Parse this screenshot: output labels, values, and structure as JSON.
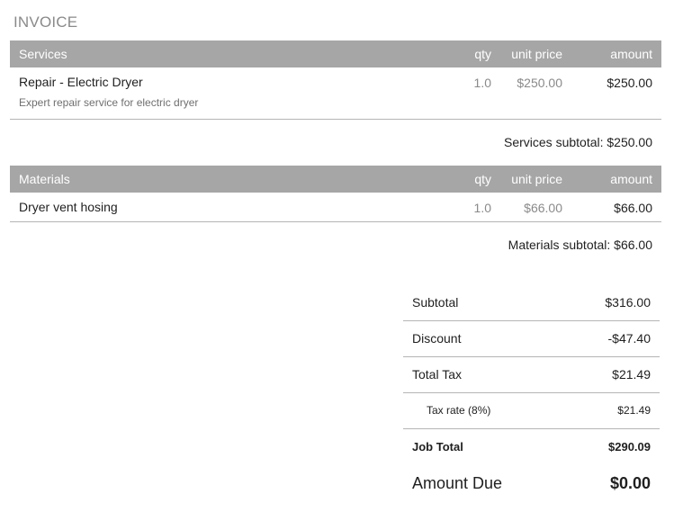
{
  "title": "INVOICE",
  "services": {
    "header": {
      "name": "Services",
      "qty": "qty",
      "unit_price": "unit price",
      "amount": "amount"
    },
    "items": [
      {
        "name": "Repair - Electric Dryer",
        "description": "Expert repair service for electric dryer",
        "qty": "1.0",
        "unit_price": "$250.00",
        "amount": "$250.00"
      }
    ],
    "subtotal": "Services subtotal: $250.00"
  },
  "materials": {
    "header": {
      "name": "Materials",
      "qty": "qty",
      "unit_price": "unit price",
      "amount": "amount"
    },
    "items": [
      {
        "name": "Dryer vent hosing",
        "qty": "1.0",
        "unit_price": "$66.00",
        "amount": "$66.00"
      }
    ],
    "subtotal": "Materials subtotal: $66.00"
  },
  "totals": {
    "subtotal": {
      "label": "Subtotal",
      "value": "$316.00"
    },
    "discount": {
      "label": "Discount",
      "value": "-$47.40"
    },
    "total_tax": {
      "label": "Total Tax",
      "value": "$21.49"
    },
    "tax_rate": {
      "label": "Tax rate (8%)",
      "value": "$21.49"
    },
    "job_total": {
      "label": "Job Total",
      "value": "$290.09"
    },
    "amount_due": {
      "label": "Amount Due",
      "value": "$0.00"
    }
  }
}
